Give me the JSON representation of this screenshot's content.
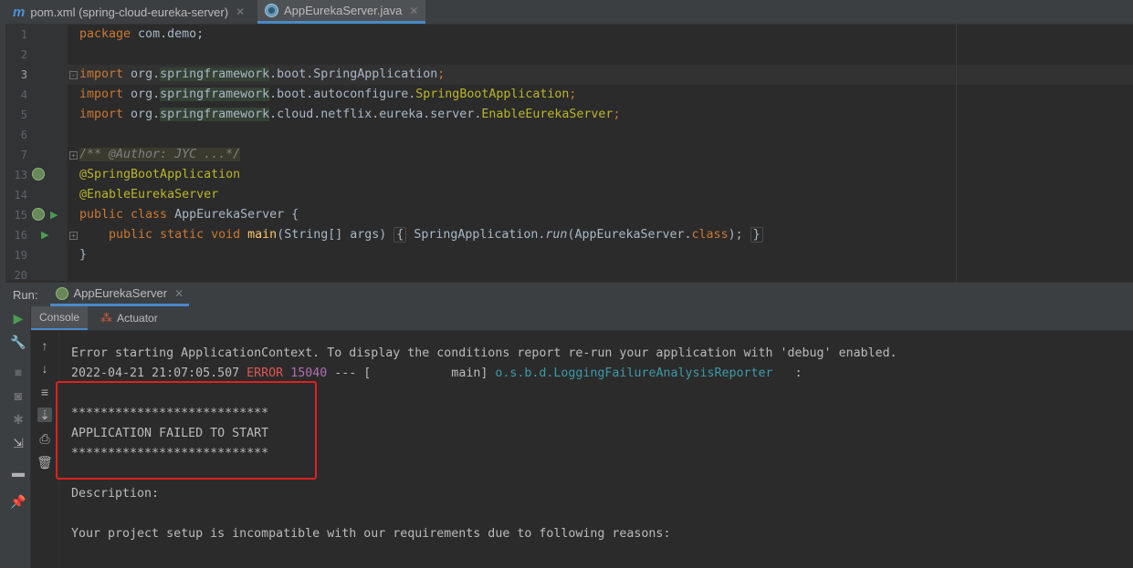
{
  "tabs": [
    {
      "label": "pom.xml (spring-cloud-eureka-server)",
      "icon": "maven-icon",
      "active": false
    },
    {
      "label": "AppEurekaServer.java",
      "icon": "java-class-icon",
      "active": true
    }
  ],
  "editor": {
    "lines": [
      {
        "num": "1"
      },
      {
        "num": "2"
      },
      {
        "num": "3"
      },
      {
        "num": "4"
      },
      {
        "num": "5"
      },
      {
        "num": "6"
      },
      {
        "num": "7"
      },
      {
        "num": "13"
      },
      {
        "num": "14"
      },
      {
        "num": "15"
      },
      {
        "num": "16"
      },
      {
        "num": "19"
      },
      {
        "num": "20"
      }
    ],
    "code": {
      "l1_kw": "package",
      "l1_rest": " com.demo;",
      "l3_kw": "import",
      "l3_a": " org.",
      "l3_b": "springframework",
      "l3_c": ".boot.SpringApplication",
      "l3_d": ";",
      "l4_kw": "import",
      "l4_a": " org.",
      "l4_b": "springframework",
      "l4_c": ".boot.autoconfigure.",
      "l4_d": "SpringBootApplication",
      "l4_e": ";",
      "l5_kw": "import",
      "l5_a": " org.",
      "l5_b": "springframework",
      "l5_c": ".cloud.netflix.eureka.server.",
      "l5_d": "EnableEurekaServer",
      "l5_e": ";",
      "l7_comment": "/** @Author: JYC ...*/",
      "l13_ann": "@SpringBootApplication",
      "l14_ann": "@EnableEurekaServer",
      "l15_kw": "public class",
      "l15_rest": " AppEurekaServer {",
      "l16_kw1": "public static void",
      "l16_fn": "main",
      "l16_args": "(String[] args)",
      "l16_open": "{",
      "l16_body1": " SpringApplication.",
      "l16_run": "run",
      "l16_body2": "(AppEurekaServer.",
      "l16_class": "class",
      "l16_body3": ");",
      "l16_close": "}",
      "l19": "}"
    }
  },
  "run": {
    "label": "Run:",
    "config": "AppEurekaServer",
    "subtabs": {
      "console": "Console",
      "actuator": "Actuator"
    }
  },
  "console": {
    "line1": "Error starting ApplicationContext. To display the conditions report re-run your application with 'debug' enabled.",
    "log_time": "2022-04-21 21:07:05.507",
    "log_level": "ERROR",
    "log_pid": "15040",
    "log_sep": " --- [           main] ",
    "log_logger": "o.s.b.d.LoggingFailureAnalysisReporter",
    "log_colon": "   :",
    "stars1": "***************************",
    "failed": "APPLICATION FAILED TO START",
    "stars2": "***************************",
    "description": "Description:",
    "reasons": "Your project setup is incompatible with our requirements due to following reasons:"
  },
  "colors": {
    "highlight_box": "#e02020",
    "active_tab_underline": "#4a88c7"
  }
}
